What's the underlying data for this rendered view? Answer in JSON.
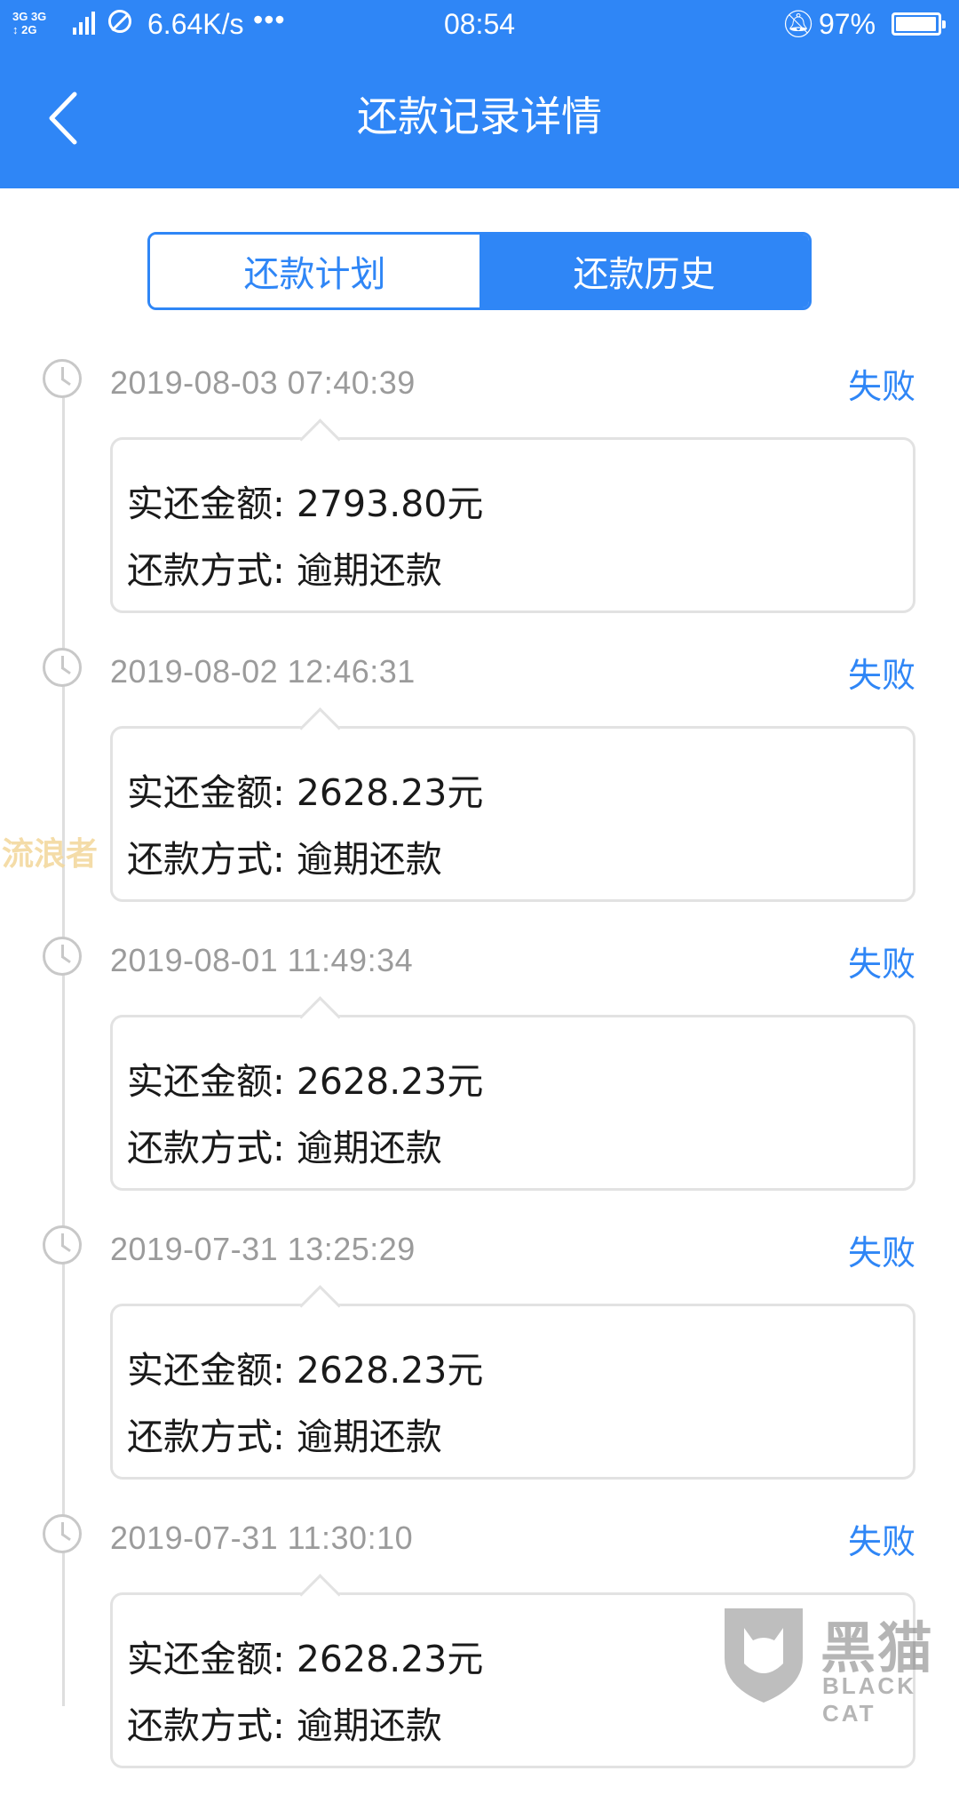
{
  "status_bar": {
    "network": "3G 3G 2G",
    "speed": "6.64K/s",
    "more": "•••",
    "time": "08:54",
    "battery_pct": "97%",
    "battery_level": 0.97
  },
  "header": {
    "title": "还款记录详情",
    "back_icon": "chevron-left-icon"
  },
  "tabs": [
    {
      "label": "还款计划",
      "active": false
    },
    {
      "label": "还款历史",
      "active": true
    }
  ],
  "records": [
    {
      "time": "2019-08-03 07:40:39",
      "status": "失败",
      "amount_line": "实还金额: 2793.80元",
      "method_line": "还款方式: 逾期还款"
    },
    {
      "time": "2019-08-02 12:46:31",
      "status": "失败",
      "amount_line": "实还金额: 2628.23元",
      "method_line": "还款方式: 逾期还款"
    },
    {
      "time": "2019-08-01 11:49:34",
      "status": "失败",
      "amount_line": "实还金额: 2628.23元",
      "method_line": "还款方式: 逾期还款"
    },
    {
      "time": "2019-07-31 13:25:29",
      "status": "失败",
      "amount_line": "实还金额: 2628.23元",
      "method_line": "还款方式: 逾期还款"
    },
    {
      "time": "2019-07-31 11:30:10",
      "status": "失败",
      "amount_line": "实还金额: 2628.23元",
      "method_line": "还款方式: 逾期还款"
    }
  ],
  "watermarks": {
    "left_text": "流浪者",
    "logo_cn": "黑猫",
    "logo_en": "BLACK CAT"
  },
  "colors": {
    "accent": "#2f86f6",
    "muted_text": "#9b9b9b",
    "card_border": "#e2e2e2"
  }
}
